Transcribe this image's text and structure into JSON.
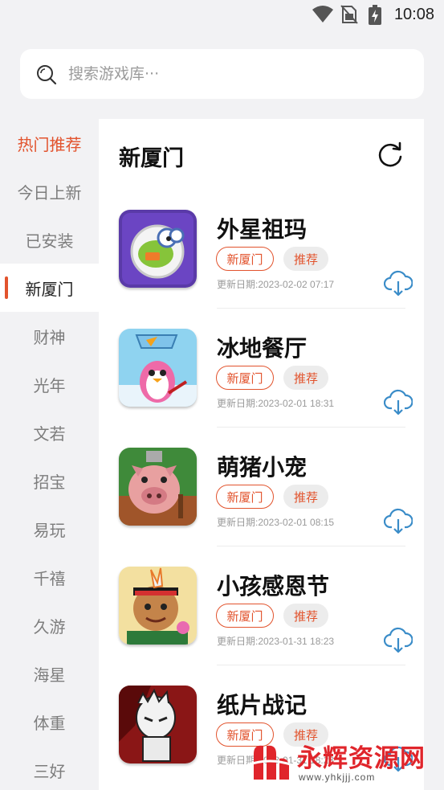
{
  "status_bar": {
    "time": "10:08",
    "icons": [
      "wifi-icon",
      "no-sim-icon",
      "battery-charging-icon"
    ]
  },
  "search": {
    "placeholder": "搜索游戏库···",
    "value": "",
    "icon": "search-icon"
  },
  "sidebar": {
    "active_index": 3,
    "accent_color": "#e2532d",
    "items": [
      {
        "label": "热门推荐"
      },
      {
        "label": "今日上新"
      },
      {
        "label": "已安装"
      },
      {
        "label": "新厦门"
      },
      {
        "label": "财神"
      },
      {
        "label": "光年"
      },
      {
        "label": "文若"
      },
      {
        "label": "招宝"
      },
      {
        "label": "易玩"
      },
      {
        "label": "千禧"
      },
      {
        "label": "久游"
      },
      {
        "label": "海星"
      },
      {
        "label": "体重"
      },
      {
        "label": "三好"
      }
    ]
  },
  "panel": {
    "title": "新厦门",
    "refresh_icon": "refresh-icon",
    "games": [
      {
        "name": "外星祖玛",
        "tags": [
          "新厦门",
          "推荐"
        ],
        "date": "更新日期:2023-02-02 07:17",
        "icon": "alien-zuma-game-icon"
      },
      {
        "name": "冰地餐厅",
        "tags": [
          "新厦门",
          "推荐"
        ],
        "date": "更新日期:2023-02-01 18:31",
        "icon": "penguin-restaurant-game-icon"
      },
      {
        "name": "萌猪小宠",
        "tags": [
          "新厦门",
          "推荐"
        ],
        "date": "更新日期:2023-02-01 08:15",
        "icon": "cute-pig-game-icon"
      },
      {
        "name": "小孩感恩节",
        "tags": [
          "新厦门",
          "推荐"
        ],
        "date": "更新日期:2023-01-31 18:23",
        "icon": "kid-thanksgiving-game-icon"
      },
      {
        "name": "纸片战记",
        "tags": [
          "新厦门",
          "推荐"
        ],
        "date": "更新日期:2023-01-31 18:23",
        "icon": "paper-war-game-icon"
      }
    ]
  },
  "watermark": {
    "text": "永辉资源网",
    "url": "www.yhkjjj.com",
    "color": "#e0252b"
  }
}
